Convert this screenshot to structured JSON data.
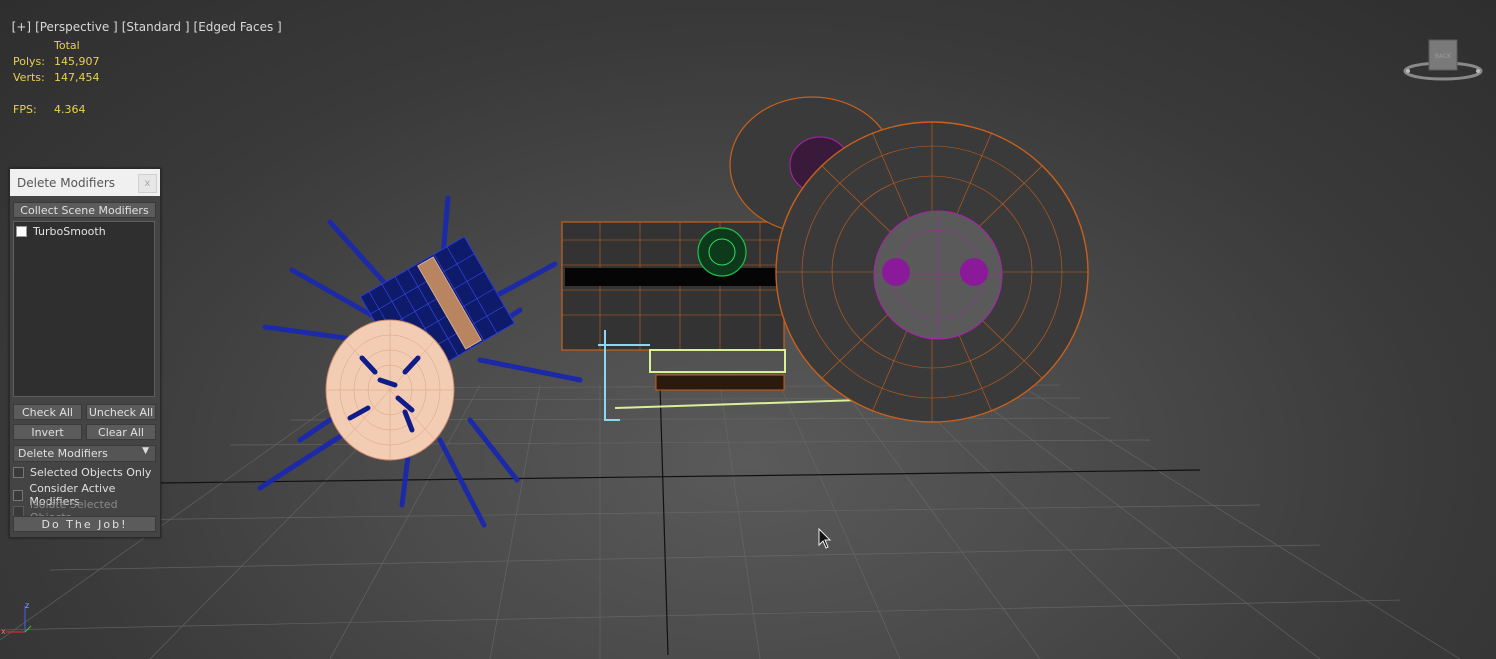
{
  "viewport": {
    "labels": [
      "[+]",
      "[Perspective ]",
      "[Standard ]",
      "[Edged Faces ]"
    ]
  },
  "stats": {
    "header": "Total",
    "polys_label": "Polys:",
    "polys": "145,907",
    "verts_label": "Verts:",
    "verts": "147,454",
    "fps_label": "FPS:",
    "fps": "4.364"
  },
  "viewcube": {
    "label": "BACK"
  },
  "panel": {
    "title": "Delete Modifiers",
    "close": "x",
    "collect_button": "Collect Scene Modifiers",
    "modifiers": [
      {
        "name": "TurboSmooth",
        "checked": false
      }
    ],
    "check_all": "Check All",
    "uncheck_all": "Uncheck All",
    "invert": "Invert",
    "clear_all": "Clear All",
    "mode_select": "Delete Modifiers",
    "selected_only": "Selected Objects Only",
    "consider_active": "Consider Active Modifiers",
    "isolate_selected": "Isolate Selected Objects",
    "do_job": "Do The Job!"
  },
  "axis": {
    "x": "x",
    "z": "z"
  }
}
